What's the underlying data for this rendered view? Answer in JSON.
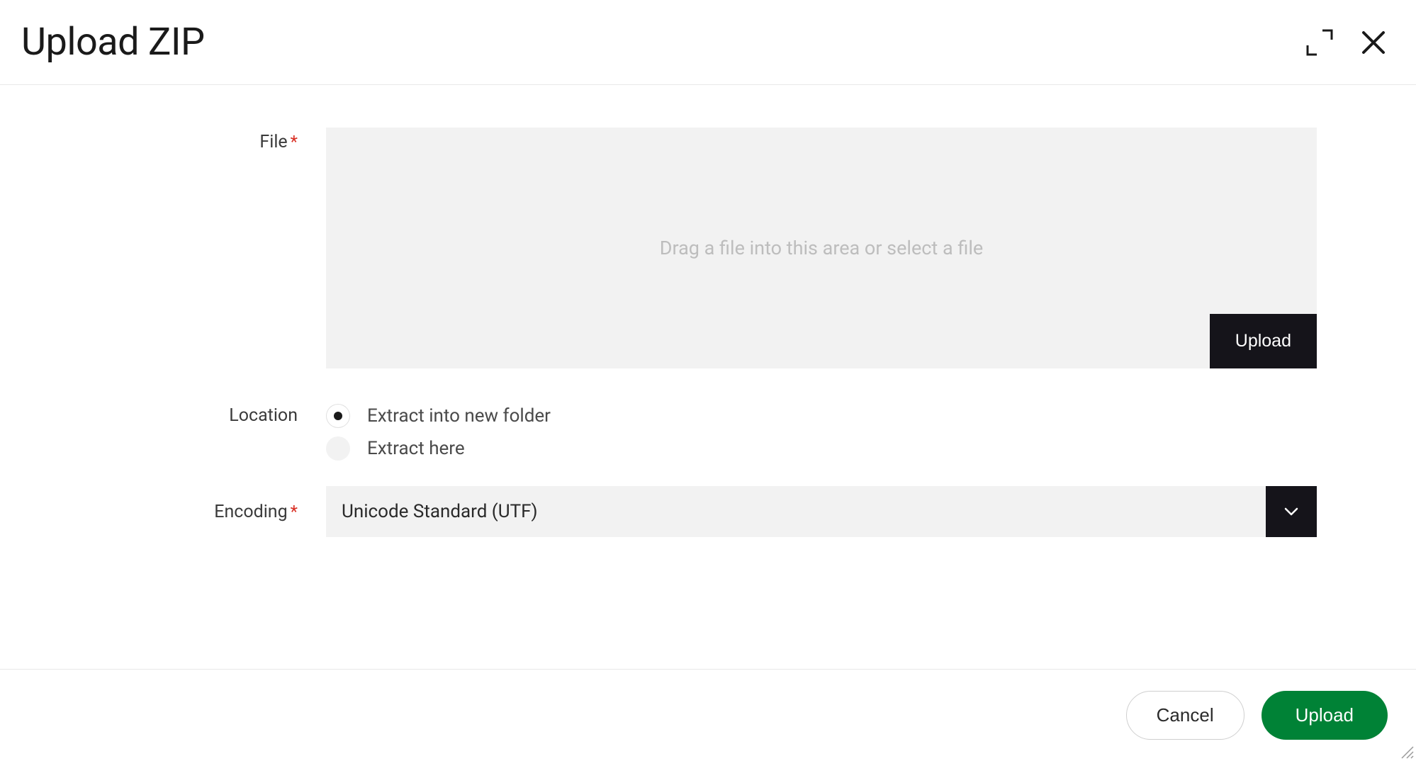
{
  "dialog": {
    "title": "Upload ZIP"
  },
  "form": {
    "file": {
      "label": "File",
      "required_mark": "*",
      "dropzone_placeholder": "Drag a file into this area or select a file",
      "upload_button": "Upload"
    },
    "location": {
      "label": "Location",
      "options": [
        {
          "label": "Extract into new folder",
          "selected": true
        },
        {
          "label": "Extract here",
          "selected": false
        }
      ]
    },
    "encoding": {
      "label": "Encoding",
      "required_mark": "*",
      "value": "Unicode Standard (UTF)"
    }
  },
  "footer": {
    "cancel": "Cancel",
    "submit": "Upload"
  }
}
